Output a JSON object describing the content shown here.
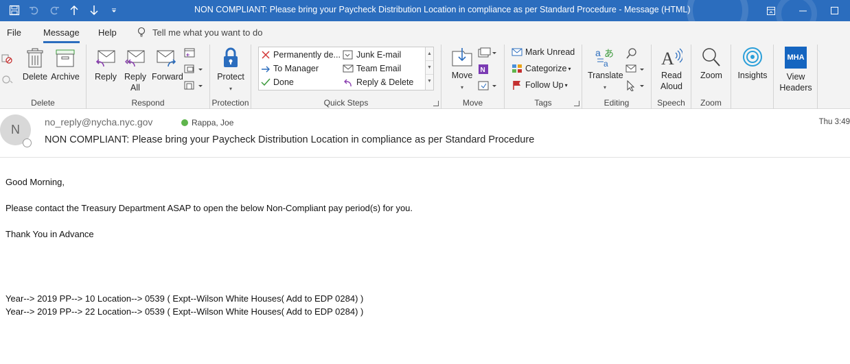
{
  "window": {
    "title": "NON COMPLIANT: Please bring your Paycheck Distribution Location in compliance as per Standard Procedure  -  Message (HTML)",
    "accent": "#2b6dbe"
  },
  "qat": [
    "save-icon",
    "undo-icon",
    "redo-icon",
    "up-arrow-icon",
    "down-arrow-icon",
    "customize-icon"
  ],
  "menu": {
    "tabs": [
      "File",
      "Message",
      "Help"
    ],
    "active": "Message",
    "tell_me": "Tell me what you want to do"
  },
  "ribbon": {
    "delete": {
      "label": "Delete",
      "delete_btn": "Delete",
      "archive_btn": "Archive"
    },
    "respond": {
      "label": "Respond",
      "reply": "Reply",
      "reply_all_1": "Reply",
      "reply_all_2": "All",
      "forward": "Forward"
    },
    "protection": {
      "label": "Protection",
      "protect": "Protect"
    },
    "quick_steps": {
      "label": "Quick Steps",
      "items": [
        "Permanently de...",
        "To Manager",
        "Done",
        "Junk E-mail",
        "Team Email",
        "Reply & Delete"
      ]
    },
    "move": {
      "label": "Move",
      "move": "Move"
    },
    "tags": {
      "label": "Tags",
      "mark_unread": "Mark Unread",
      "categorize": "Categorize",
      "follow_up": "Follow Up"
    },
    "editing": {
      "label": "Editing",
      "translate": "Translate"
    },
    "speech": {
      "label": "Speech",
      "read_1": "Read",
      "read_2": "Aloud"
    },
    "zoom": {
      "label": "Zoom",
      "zoom": "Zoom"
    },
    "insights": {
      "insights": "Insights"
    },
    "mha": {
      "badge": "MHA",
      "view_1": "View",
      "view_2": "Headers"
    }
  },
  "message": {
    "avatar_initial": "N",
    "from": "no_reply@nycha.nyc.gov",
    "to": "Rappa, Joe",
    "subject": "NON COMPLIANT: Please bring your Paycheck Distribution Location in compliance as per Standard Procedure",
    "time": "Thu 3:49",
    "body": {
      "greeting": "Good Morning,",
      "line1": "Please contact the Treasury Department ASAP to open the below Non-Compliant pay period(s) for you.",
      "thanks": "Thank You in Advance",
      "record1": "Year--> 2019 PP--> 10 Location--> 0539 ( Expt--Wilson White Houses( Add to EDP 0284) )",
      "record2": "Year--> 2019 PP--> 22 Location--> 0539 ( Expt--Wilson White Houses( Add to EDP 0284) )"
    }
  }
}
